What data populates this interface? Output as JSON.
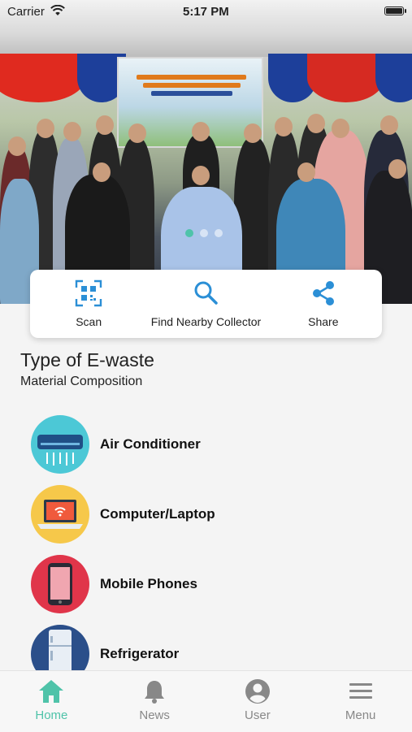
{
  "status_bar": {
    "carrier": "Carrier",
    "time": "5:17 PM"
  },
  "hero": {
    "slides": 3,
    "active_slide": 1
  },
  "actions": [
    {
      "label": "Scan",
      "icon": "qr-scan-icon"
    },
    {
      "label": "Find Nearby Collector",
      "icon": "search-icon"
    },
    {
      "label": "Share",
      "icon": "share-icon"
    }
  ],
  "section": {
    "title": "Type of E-waste",
    "subtitle": "Material Composition"
  },
  "ewaste_types": [
    {
      "label": "Air Conditioner",
      "icon": "air-conditioner-icon",
      "color": "#4cc8d6"
    },
    {
      "label": "Computer/Laptop",
      "icon": "laptop-icon",
      "color": "#f6c84a"
    },
    {
      "label": "Mobile Phones",
      "icon": "mobile-phone-icon",
      "color": "#e0354a"
    },
    {
      "label": "Refrigerator",
      "icon": "refrigerator-icon",
      "color": "#2b4f8a"
    }
  ],
  "tabs": [
    {
      "label": "Home",
      "icon": "home-icon",
      "active": true
    },
    {
      "label": "News",
      "icon": "bell-icon",
      "active": false
    },
    {
      "label": "User",
      "icon": "user-icon",
      "active": false
    },
    {
      "label": "Menu",
      "icon": "menu-icon",
      "active": false
    }
  ],
  "colors": {
    "accent": "#4fc3a9",
    "icon_blue": "#2b8fd6",
    "inactive_tab": "#888888"
  }
}
